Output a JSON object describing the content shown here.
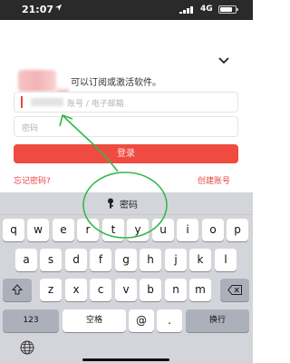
{
  "status_bar": {
    "time": "21:07",
    "network": "4G"
  },
  "login": {
    "subtitle": "可以订阅或激活软件。",
    "account_placeholder": "账号 / 电子邮箱",
    "password_placeholder": "密码",
    "login_button": "登录",
    "forgot_password": "忘记密码?",
    "create_account": "创建账号"
  },
  "keyboard": {
    "suggestion": "密码",
    "row1": [
      "q",
      "w",
      "e",
      "r",
      "t",
      "y",
      "u",
      "i",
      "o",
      "p"
    ],
    "row2": [
      "a",
      "s",
      "d",
      "f",
      "g",
      "h",
      "j",
      "k",
      "l"
    ],
    "row3": [
      "z",
      "x",
      "c",
      "v",
      "b",
      "n",
      "m"
    ],
    "numbers_key": "123",
    "space_key": "空格",
    "at_key": "@",
    "dot_key": ".",
    "return_key": "换行"
  },
  "colors": {
    "accent": "#ef4b40",
    "annotation": "#35b84a"
  },
  "icons": [
    "location-arrow-icon",
    "signal-icon",
    "battery-icon",
    "chevron-down-icon",
    "key-icon",
    "shift-icon",
    "delete-icon",
    "globe-icon"
  ]
}
